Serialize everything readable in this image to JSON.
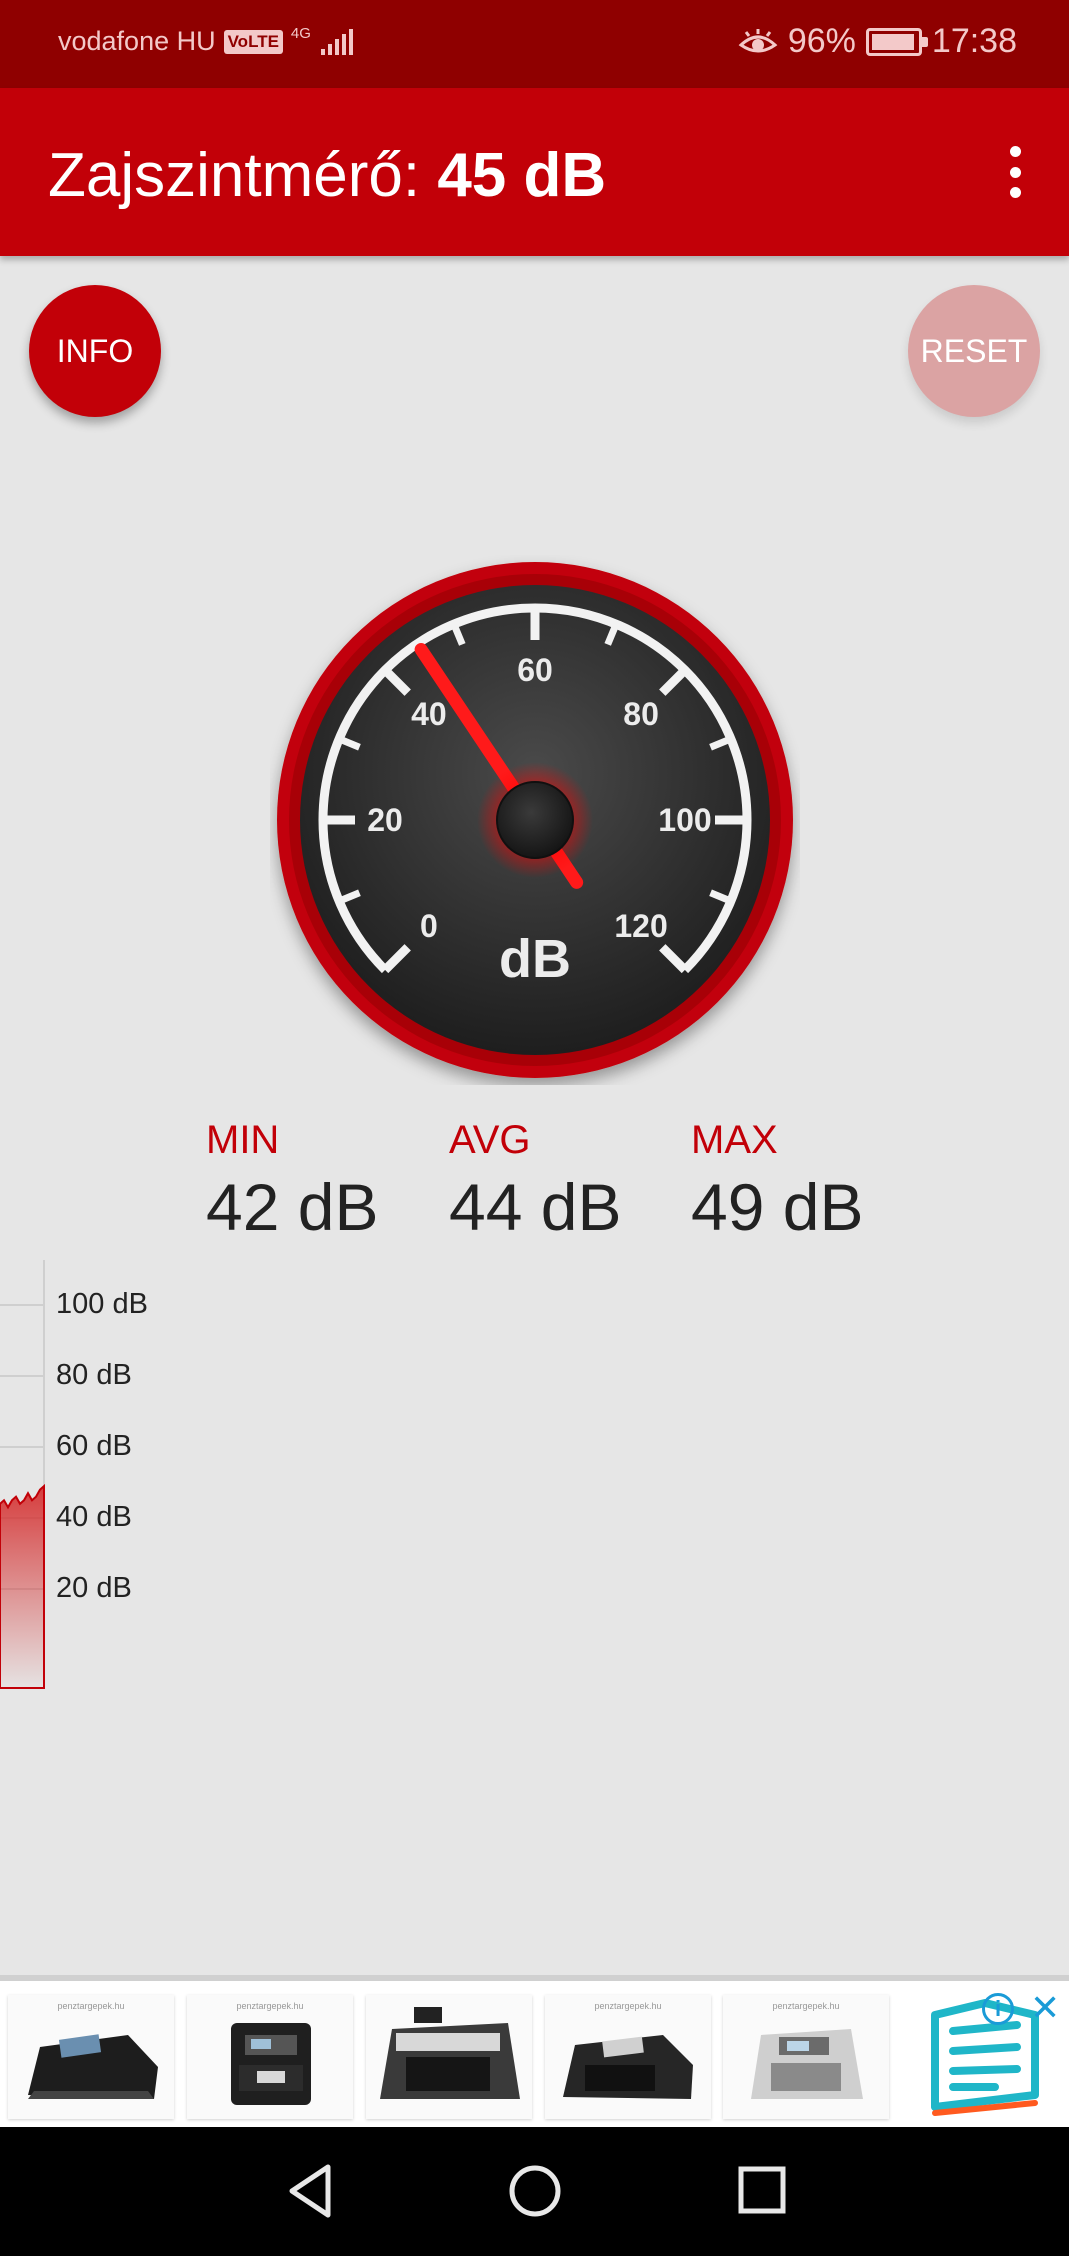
{
  "status_bar": {
    "carrier": "vodafone HU",
    "volte": "VoLTE",
    "network": "4G",
    "battery_percent": "96%",
    "battery_level": 0.96,
    "time": "17:38"
  },
  "app_bar": {
    "title_prefix": "Zajszintmérő:",
    "title_value": "45 dB"
  },
  "buttons": {
    "info": "INFO",
    "reset": "RESET"
  },
  "gauge": {
    "current_value": 45,
    "unit": "dB",
    "min": 0,
    "max": 120,
    "major_ticks": [
      "0",
      "20",
      "40",
      "60",
      "80",
      "100",
      "120"
    ],
    "colors": {
      "rim": "#c20008",
      "face": "#2b2b2b",
      "needle": "#ff1a1a"
    }
  },
  "stats": [
    {
      "label": "MIN",
      "value": "42 dB"
    },
    {
      "label": "AVG",
      "value": "44 dB"
    },
    {
      "label": "MAX",
      "value": "49 dB"
    }
  ],
  "history": {
    "labels": [
      "100 dB",
      "80 dB",
      "60 dB",
      "40 dB",
      "20 dB"
    ],
    "samples": [
      44,
      45,
      43,
      45,
      46,
      44,
      45,
      47,
      45,
      46,
      48,
      49
    ]
  },
  "ad": {
    "tag": "penztargepek.hu",
    "info_icon": "info-icon",
    "close_icon": "close-icon"
  },
  "nav": [
    "back-icon",
    "home-icon",
    "recents-icon"
  ]
}
